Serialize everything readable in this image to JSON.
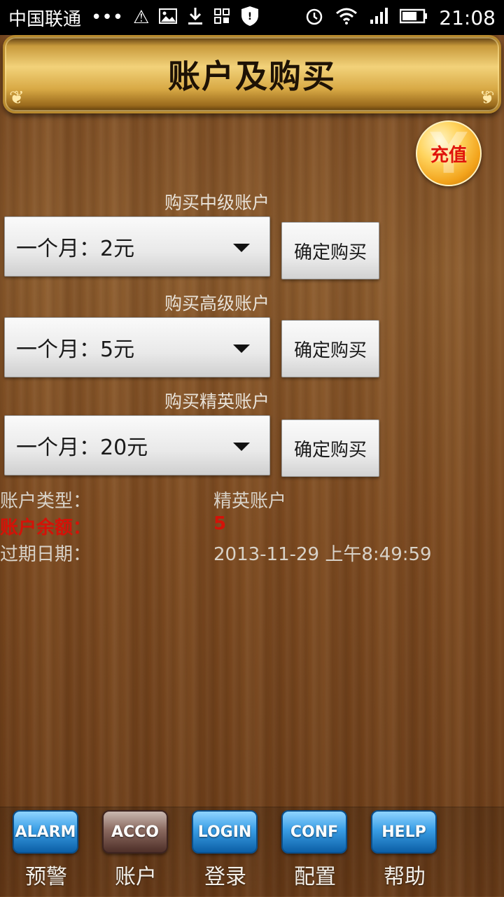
{
  "statusbar": {
    "carrier": "中国联通",
    "dots": "•••",
    "time": "21:08",
    "icons": [
      "warning-icon",
      "image-icon",
      "download-icon",
      "grid-icon",
      "shield-icon",
      "alarm-icon",
      "wifi-icon",
      "signal-icon",
      "battery-icon"
    ]
  },
  "header": {
    "title": "账户及购买"
  },
  "recharge": {
    "label": "充值",
    "symbol": "¥"
  },
  "purchases": [
    {
      "section_label": "购买中级账户",
      "selected": "一个月：2元",
      "button": "确定购买"
    },
    {
      "section_label": "购买高级账户",
      "selected": "一个月：5元",
      "button": "确定购买"
    },
    {
      "section_label": "购买精英账户",
      "selected": "一个月：20元",
      "button": "确定购买"
    }
  ],
  "account_info": [
    {
      "key": "账户类型：",
      "value": "精英账户",
      "color": "#d8d2c8"
    },
    {
      "key": "账户余额：",
      "value": "5",
      "color": "#d41208"
    },
    {
      "key": "过期日期：",
      "value": "2013-11-29 上午8:49:59",
      "color": "#d8d2c8"
    }
  ],
  "tabs": [
    {
      "badge": "ALARM",
      "label": "预警"
    },
    {
      "badge": "ACCO",
      "label": "账户"
    },
    {
      "badge": "LOGIN",
      "label": "登录"
    },
    {
      "badge": "CONF",
      "label": "配置"
    },
    {
      "badge": "HELP",
      "label": "帮助"
    }
  ],
  "active_tab": "账户"
}
